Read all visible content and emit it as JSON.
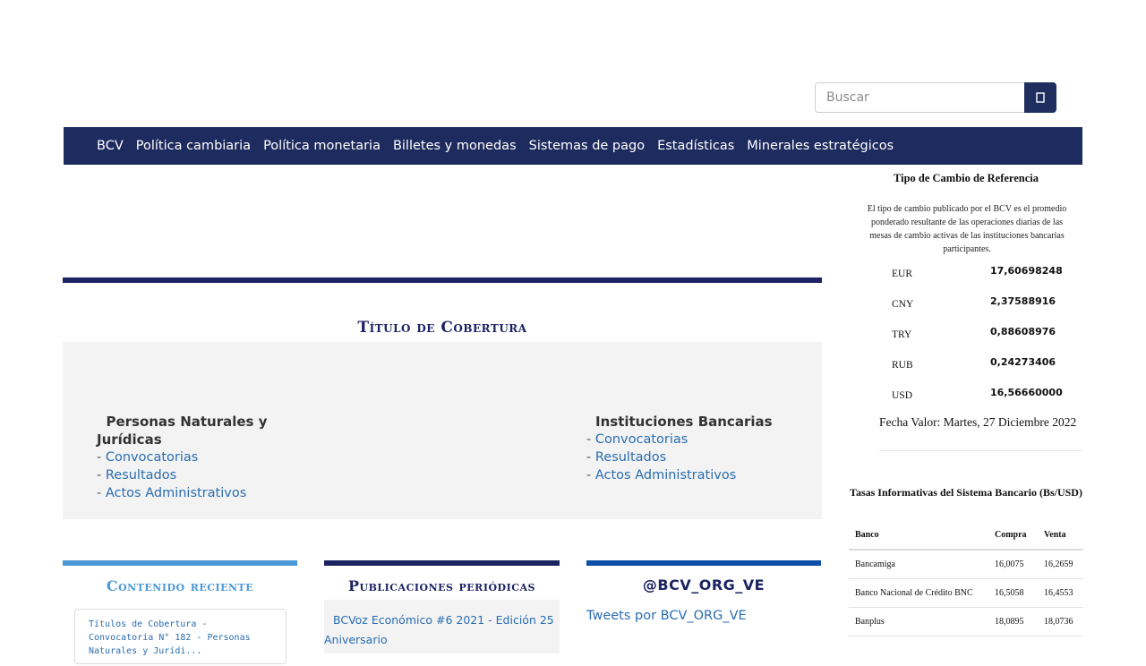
{
  "search": {
    "placeholder": "Buscar",
    "button_icon": "search-icon"
  },
  "nav": {
    "items": [
      "BCV",
      "Política cambiaria",
      "Política monetaria",
      "Billetes y monedas",
      "Sistemas de pago",
      "Estadísticas",
      "Minerales estratégicos"
    ]
  },
  "cobertura": {
    "title": "Título de Cobertura",
    "left": {
      "heading": "Personas Naturales y Jurídicas",
      "links": [
        "Convocatorias",
        "Resultados",
        "Actos Administrativos"
      ]
    },
    "right": {
      "heading": "Instituciones Bancarias",
      "links": [
        "Convocatorias",
        "Resultados",
        "Actos Administrativos"
      ]
    }
  },
  "panels": {
    "recent": {
      "title": "Contenido reciente",
      "item": "Títulos de Cobertura - Convocatoria N° 182 - Personas Naturales y Jurídi..."
    },
    "publications": {
      "title": "Publicaciones periódicas",
      "item": "BCVoz Económico #6 2021 - Edición 25 Aniversario"
    },
    "twitter": {
      "title": "@BCV_ORG_VE",
      "item": "Tweets por BCV_ORG_VE"
    }
  },
  "sidebar": {
    "title": "Tipo de Cambio de Referencia",
    "description": "El tipo de cambio publicado por el BCV es el promedio ponderado resultante de las operaciones diarias de las mesas de cambio activas de las instituciones bancarias participantes.",
    "rates": [
      {
        "currency": "EUR",
        "value": "17,60698248"
      },
      {
        "currency": "CNY",
        "value": "2,37588916"
      },
      {
        "currency": "TRY",
        "value": "0,88608976"
      },
      {
        "currency": "RUB",
        "value": "0,24273406"
      },
      {
        "currency": "USD",
        "value": "16,56660000"
      }
    ],
    "fecha_valor": "Fecha Valor: Martes, 27 Diciembre 2022",
    "tasas": {
      "title": "Tasas Informativas del Sistema Bancario (Bs/USD)",
      "headers": [
        "Banco",
        "Compra",
        "Venta"
      ],
      "rows": [
        [
          "Bancamiga",
          "16,0075",
          "16,2659"
        ],
        [
          "Banco Nacional de Crédito BNC",
          "16,5058",
          "16,4553"
        ],
        [
          "Banplus",
          "18,0895",
          "18,0736"
        ]
      ]
    }
  },
  "colors": {
    "navy": "#1e2b5e",
    "rule": "#1b2362",
    "link": "#2a6db0",
    "panel_recent": "#4a98d6",
    "panel_twitter": "#0d4ea6"
  }
}
